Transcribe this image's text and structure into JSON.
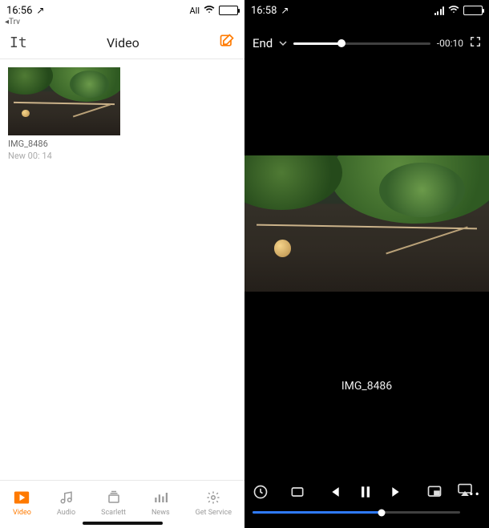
{
  "left": {
    "statusbar": {
      "time": "16:56",
      "location_indicator": "↗",
      "back_app": "◂Trv",
      "network_label": "All"
    },
    "header": {
      "back_glyph": "It",
      "title": "Video",
      "edit_icon": "compose-icon"
    },
    "items": [
      {
        "name": "IMG_8486",
        "subtitle": "New 00: 14"
      }
    ],
    "tabs": [
      {
        "label": "Video",
        "icon": "play-icon",
        "active": true
      },
      {
        "label": "Audio",
        "icon": "music-note-icon",
        "active": false
      },
      {
        "label": "Scarlett",
        "icon": "stack-icon",
        "active": false
      },
      {
        "label": "News",
        "icon": "bars-icon",
        "active": false
      },
      {
        "label": "Get Service",
        "icon": "gear-icon",
        "active": false
      }
    ]
  },
  "right": {
    "statusbar": {
      "time": "16:58",
      "location_indicator": "↗"
    },
    "player": {
      "mode_label": "End",
      "volume_percent": 35,
      "time_remaining": "-00:10",
      "title": "IMG_8486",
      "progress_percent": 62
    },
    "controls": {
      "history_icon": "clock-icon",
      "repeat_icon": "repeat-icon",
      "prev_icon": "skip-back-icon",
      "playpause_icon": "pause-icon",
      "next_icon": "skip-forward-icon",
      "pip_icon": "pip-icon",
      "more_label": "•••",
      "cast_icon": "airplay-icon"
    }
  }
}
